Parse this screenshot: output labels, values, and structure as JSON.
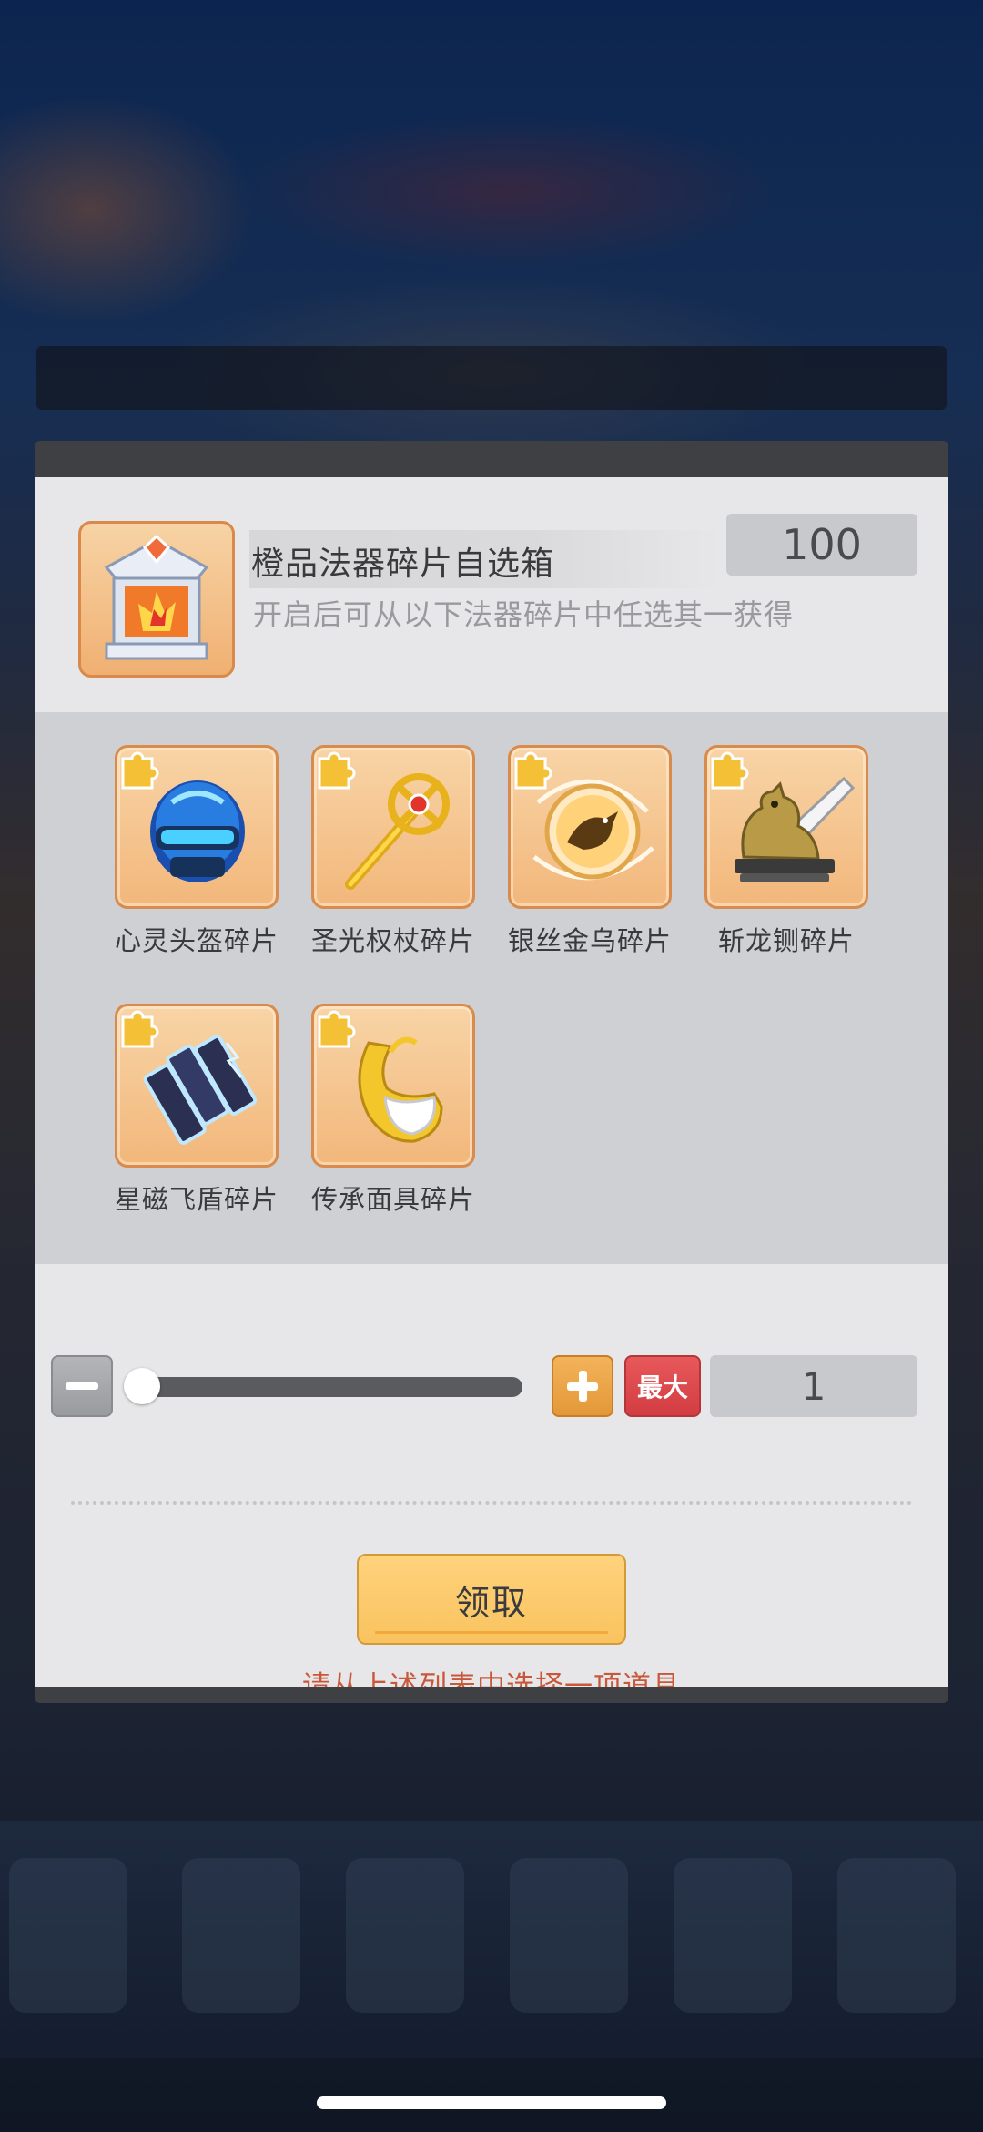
{
  "chest": {
    "icon": "orange-artifact-chest-icon",
    "title": "橙品法器碎片自选箱",
    "count": "100",
    "description": "开启后可从以下法器碎片中任选其一获得"
  },
  "items": [
    {
      "label": "心灵头盔碎片",
      "icon": "helmet-icon"
    },
    {
      "label": "圣光权杖碎片",
      "icon": "scepter-icon"
    },
    {
      "label": "银丝金乌碎片",
      "icon": "golden-crow-orb-icon"
    },
    {
      "label": "斩龙铡碎片",
      "icon": "dragon-guillotine-icon"
    },
    {
      "label": "星磁飞盾碎片",
      "icon": "flying-shield-icon"
    },
    {
      "label": "传承面具碎片",
      "icon": "mask-icon"
    }
  ],
  "quantity": {
    "value": "1",
    "max_label": "最大",
    "slider_fraction": 0
  },
  "actions": {
    "claim_label": "领取",
    "hint": "请从上述列表中选择一项道具"
  },
  "colors": {
    "tile_border": "#d88b4b",
    "claim_button": "#f9c35f",
    "max_button": "#d23d42",
    "plus_button": "#e39838",
    "hint_text": "#c9583b"
  }
}
